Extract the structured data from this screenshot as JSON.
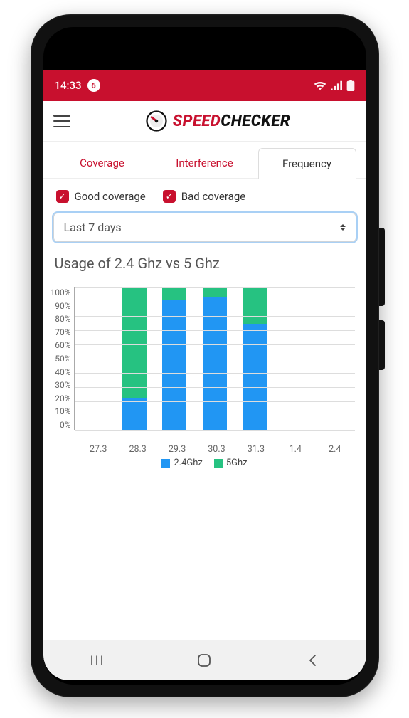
{
  "status": {
    "time": "14:33",
    "notification_count": "6"
  },
  "brand": {
    "word1": "SPEED",
    "word2": "CHECKER"
  },
  "tabs": [
    "Coverage",
    "Interference",
    "Frequency"
  ],
  "tabs_active_index": 2,
  "filters": {
    "good_label": "Good coverage",
    "bad_label": "Bad coverage",
    "range_label": "Last 7 days"
  },
  "chart_title": "Usage of 2.4 Ghz vs 5 Ghz",
  "chart_data": {
    "type": "bar",
    "title": "Usage of 2.4 Ghz vs 5 Ghz",
    "categories": [
      "27.3",
      "28.3",
      "29.3",
      "30.3",
      "31.3",
      "1.4",
      "2.4"
    ],
    "series": [
      {
        "name": "2.4Ghz",
        "values": [
          0,
          22,
          91,
          93,
          74,
          0,
          0
        ]
      },
      {
        "name": "5Ghz",
        "values": [
          0,
          78,
          9,
          7,
          26,
          0,
          0
        ]
      }
    ],
    "ylabel": "",
    "xlabel": "",
    "ylim": [
      0,
      100
    ],
    "y_ticks": [
      "100%",
      "90%",
      "80%",
      "70%",
      "60%",
      "50%",
      "40%",
      "30%",
      "20%",
      "10%",
      "0%"
    ],
    "legend": [
      "2.4Ghz",
      "5Ghz"
    ],
    "colors": {
      "2.4Ghz": "#2196f3",
      "5Ghz": "#26c281"
    }
  }
}
